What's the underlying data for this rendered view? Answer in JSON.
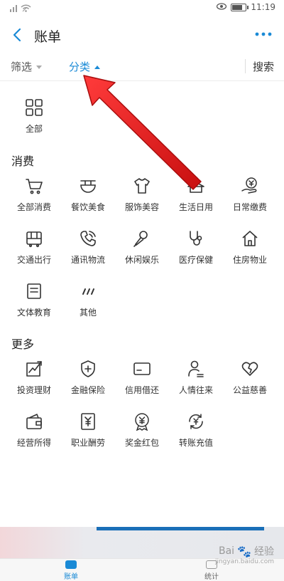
{
  "status_bar": {
    "signal": "᠁",
    "time": "11:19"
  },
  "header": {
    "title": "账单"
  },
  "filter_bar": {
    "filter_label": "筛选",
    "category_label": "分类",
    "search_label": "搜索"
  },
  "all_item": {
    "label": "全部",
    "icon": "grid-icon"
  },
  "sections": {
    "consumption": {
      "title": "消费",
      "items": [
        {
          "label": "全部消费",
          "icon": "cart-icon"
        },
        {
          "label": "餐饮美食",
          "icon": "bowl-icon"
        },
        {
          "label": "服饰美容",
          "icon": "tshirt-icon"
        },
        {
          "label": "生活日用",
          "icon": "hanger-icon"
        },
        {
          "label": "日常缴费",
          "icon": "coin-hand-icon"
        },
        {
          "label": "交通出行",
          "icon": "bus-icon"
        },
        {
          "label": "通讯物流",
          "icon": "phone-icon"
        },
        {
          "label": "休闲娱乐",
          "icon": "microphone-icon"
        },
        {
          "label": "医疗保健",
          "icon": "stethoscope-icon"
        },
        {
          "label": "住房物业",
          "icon": "house-icon"
        },
        {
          "label": "文体教育",
          "icon": "book-icon"
        },
        {
          "label": "其他",
          "icon": "slashes-icon"
        }
      ]
    },
    "more": {
      "title": "更多",
      "items": [
        {
          "label": "投资理财",
          "icon": "chart-icon"
        },
        {
          "label": "金融保险",
          "icon": "shield-icon"
        },
        {
          "label": "信用借还",
          "icon": "card-icon"
        },
        {
          "label": "人情往来",
          "icon": "person-icon"
        },
        {
          "label": "公益慈善",
          "icon": "heart-icon"
        },
        {
          "label": "经营所得",
          "icon": "wallet-icon"
        },
        {
          "label": "职业酬劳",
          "icon": "yen-doc-icon"
        },
        {
          "label": "奖金红包",
          "icon": "medal-icon"
        },
        {
          "label": "转账充值",
          "icon": "refresh-yen-icon"
        }
      ]
    }
  },
  "tabbar": {
    "bill_label": "账单",
    "stats_label": "统计"
  },
  "watermark": {
    "brand": "Bai",
    "brand_suffix": "经验",
    "url": "jingyan.baidu.com"
  },
  "colors": {
    "accent": "#1a8ad6",
    "arrow": "#e02020",
    "icon_stroke": "#333333"
  }
}
